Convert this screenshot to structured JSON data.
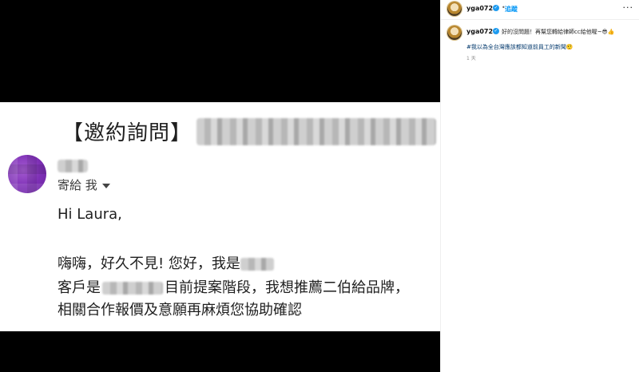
{
  "media": {
    "email": {
      "subject": "【邀約詢問】",
      "to_label": "寄給 我",
      "greeting": "Hi Laura,",
      "line1": "嗨嗨，好久不見! 您好，我是",
      "line2_a": "客戶是",
      "line2_b": "目前提案階段，我想推薦二伯給品牌，",
      "line3": "相關合作報價及意願再麻煩您協助確認"
    }
  },
  "post": {
    "header": {
      "username": "yga0721",
      "verified_icon": "verified-badge",
      "separator": "•",
      "follow_label": "追蹤",
      "more_label": "···"
    },
    "caption": {
      "username": "yga0721",
      "text": "好的沒問題！再幫您轉給律師cc給他喔~😎👍",
      "hashtag": "#我以為全台灣應該都知道前員工的新聞🤨",
      "time": "1 天"
    }
  },
  "colors": {
    "media_background": "#000000",
    "link_blue": "#0095f6",
    "hashtag_blue": "#00376b",
    "verified_blue": "#1d9bf0",
    "avatar_purple": "#7d2fb5"
  }
}
